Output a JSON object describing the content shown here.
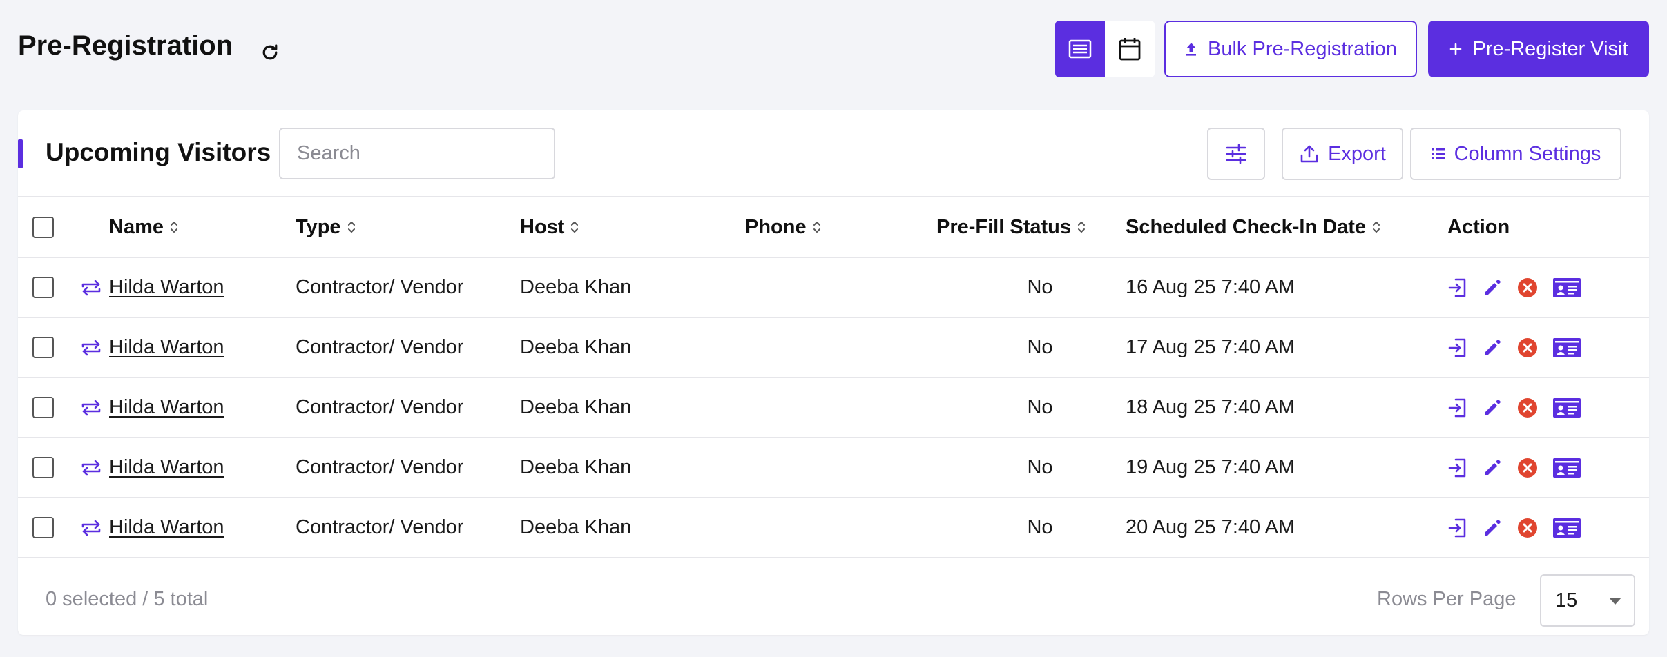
{
  "header": {
    "title": "Pre-Registration",
    "refresh_icon": "refresh-icon",
    "view_list_icon": "list-view-icon",
    "view_calendar_icon": "calendar-icon",
    "bulk_label": "Bulk Pre-Registration",
    "prereg_label": "Pre-Register Visit",
    "accent_color": "#5b2ee0"
  },
  "card": {
    "title": "Upcoming Visitors",
    "search_placeholder": "Search",
    "filter_icon": "sliders-icon",
    "export_label": "Export",
    "column_settings_label": "Column Settings"
  },
  "table": {
    "columns": [
      "Name",
      "Type",
      "Host",
      "Phone",
      "Pre-Fill Status",
      "Scheduled Check-In Date",
      "Action"
    ],
    "rows": [
      {
        "name": "Hilda Warton",
        "type": "Contractor/ Vendor",
        "host": "Deeba Khan",
        "phone": "",
        "prefill": "No",
        "date": "16 Aug 25 7:40 AM"
      },
      {
        "name": "Hilda Warton",
        "type": "Contractor/ Vendor",
        "host": "Deeba Khan",
        "phone": "",
        "prefill": "No",
        "date": "17 Aug 25 7:40 AM"
      },
      {
        "name": "Hilda Warton",
        "type": "Contractor/ Vendor",
        "host": "Deeba Khan",
        "phone": "",
        "prefill": "No",
        "date": "18 Aug 25 7:40 AM"
      },
      {
        "name": "Hilda Warton",
        "type": "Contractor/ Vendor",
        "host": "Deeba Khan",
        "phone": "",
        "prefill": "No",
        "date": "19 Aug 25 7:40 AM"
      },
      {
        "name": "Hilda Warton",
        "type": "Contractor/ Vendor",
        "host": "Deeba Khan",
        "phone": "",
        "prefill": "No",
        "date": "20 Aug 25 7:40 AM"
      }
    ],
    "action_icons": [
      "check-in-icon",
      "edit-pencil-icon",
      "cancel-icon",
      "badge-card-icon"
    ],
    "cancel_color": "#e0452f"
  },
  "footer": {
    "selection": "0 selected / 5 total",
    "rows_per_page_label": "Rows Per Page",
    "rows_per_page_value": "15"
  }
}
